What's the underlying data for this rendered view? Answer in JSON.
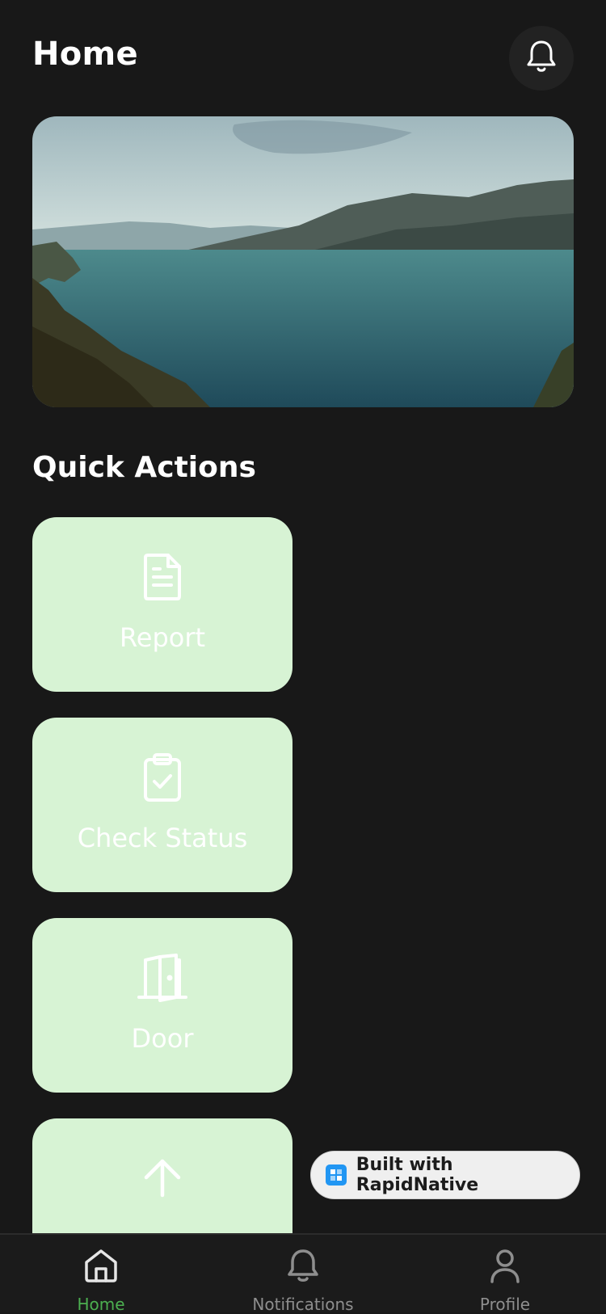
{
  "header": {
    "title": "Home",
    "notification_icon": "bell-icon"
  },
  "hero": {
    "image": "lake-mountains-landscape"
  },
  "quick_actions": {
    "title": "Quick Actions",
    "items": [
      {
        "label": "Report",
        "icon": "document-icon"
      },
      {
        "label": "Check Status",
        "icon": "clipboard-check-icon"
      },
      {
        "label": "Door",
        "icon": "door-icon"
      },
      {
        "label": "",
        "icon": "arrow-up-icon"
      }
    ],
    "card_color": "#d7f3d4"
  },
  "badge": {
    "text": "Built with RapidNative",
    "logo_color": "#2196f3"
  },
  "tabbar": {
    "tabs": [
      {
        "label": "Home",
        "icon": "home-icon",
        "active": true
      },
      {
        "label": "Notifications",
        "icon": "bell-icon",
        "active": false
      },
      {
        "label": "Profile",
        "icon": "user-icon",
        "active": false
      }
    ],
    "active_color": "#4caf50",
    "inactive_color": "#8e8e8e"
  }
}
